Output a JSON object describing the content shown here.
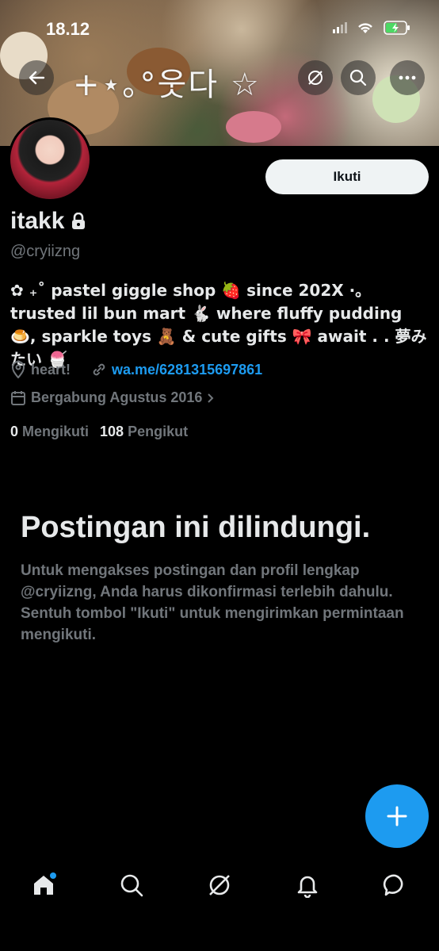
{
  "status_bar": {
    "time": "18.12"
  },
  "banner": {
    "caption": "+⋆｡°웃다 ☆"
  },
  "header": {
    "back_label": "back",
    "follow_label": "Ikuti"
  },
  "profile": {
    "display_name": "itakk",
    "handle": "@cryiizng",
    "bio": "✿ ₊˚ pastel giggle shop 🍓 since 202X ⋅｡ trusted lil bun mart 🐇 where fluffy pudding 🍮, sparkle toys 🧸 & cute gifts 🎀 await . . 夢みたい 🍧",
    "location": "heart!",
    "website": "wa.me/6281315697861",
    "joined": "Bergabung Agustus 2016",
    "following_count": "0",
    "following_label": "Mengikuti",
    "followers_count": "108",
    "followers_label": "Pengikut"
  },
  "protected": {
    "title": "Postingan ini dilindungi.",
    "body": "Untuk mengakses postingan dan profil lengkap @cryiizng, Anda harus dikonfirmasi terlebih dahulu. Sentuh tombol \"Ikuti\" untuk mengirimkan permintaan mengikuti."
  },
  "colors": {
    "accent": "#1d9bf0",
    "text": "#e7e9ea",
    "muted": "#71767b",
    "background": "#000000"
  },
  "bottom_nav": [
    {
      "icon": "home-icon"
    },
    {
      "icon": "search-icon"
    },
    {
      "icon": "grok-icon"
    },
    {
      "icon": "bell-icon"
    },
    {
      "icon": "messages-icon"
    }
  ]
}
